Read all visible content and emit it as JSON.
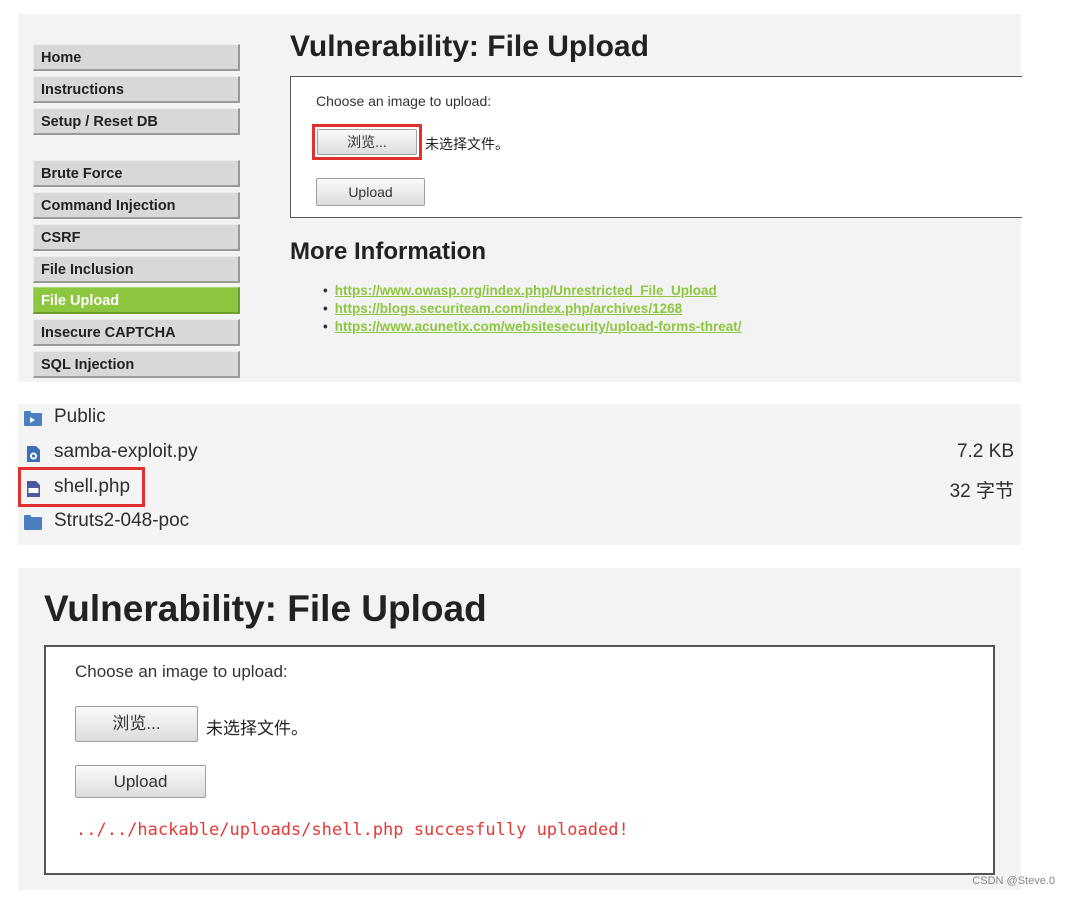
{
  "top_panel": {
    "menu_group1": [
      "Home",
      "Instructions",
      "Setup / Reset DB"
    ],
    "menu_group2": [
      "Brute Force",
      "Command Injection",
      "CSRF",
      "File Inclusion",
      "File Upload",
      "Insecure CAPTCHA",
      "SQL Injection"
    ],
    "active_item": "File Upload",
    "page_title": "Vulnerability: File Upload",
    "prompt": "Choose an image to upload:",
    "browse_label": "浏览...",
    "no_file_text": "未选择文件。",
    "upload_label": "Upload",
    "more_info_title": "More Information",
    "links": [
      "https://www.owasp.org/index.php/Unrestricted_File_Upload",
      "https://blogs.securiteam.com/index.php/archives/1268",
      "https://www.acunetix.com/websitesecurity/upload-forms-threat/"
    ]
  },
  "file_list": {
    "files": [
      {
        "name": "Public",
        "size": "",
        "icon": "folder-share-icon"
      },
      {
        "name": "samba-exploit.py",
        "size": "7.2 KB",
        "icon": "python-file-icon"
      },
      {
        "name": "shell.php",
        "size": "32 字节",
        "icon": "php-file-icon"
      },
      {
        "name": "Struts2-048-poc",
        "size": "",
        "icon": "folder-icon"
      }
    ]
  },
  "bottom_panel": {
    "page_title": "Vulnerability: File Upload",
    "prompt": "Choose an image to upload:",
    "browse_label": "浏览...",
    "no_file_text": "未选择文件。",
    "upload_label": "Upload",
    "success_message": "../../hackable/uploads/shell.php succesfully uploaded!"
  },
  "credit": "CSDN @Steve.0",
  "colors": {
    "accent_green": "#8dc63f",
    "highlight_red": "#e0312f",
    "success_red": "#e53935"
  }
}
